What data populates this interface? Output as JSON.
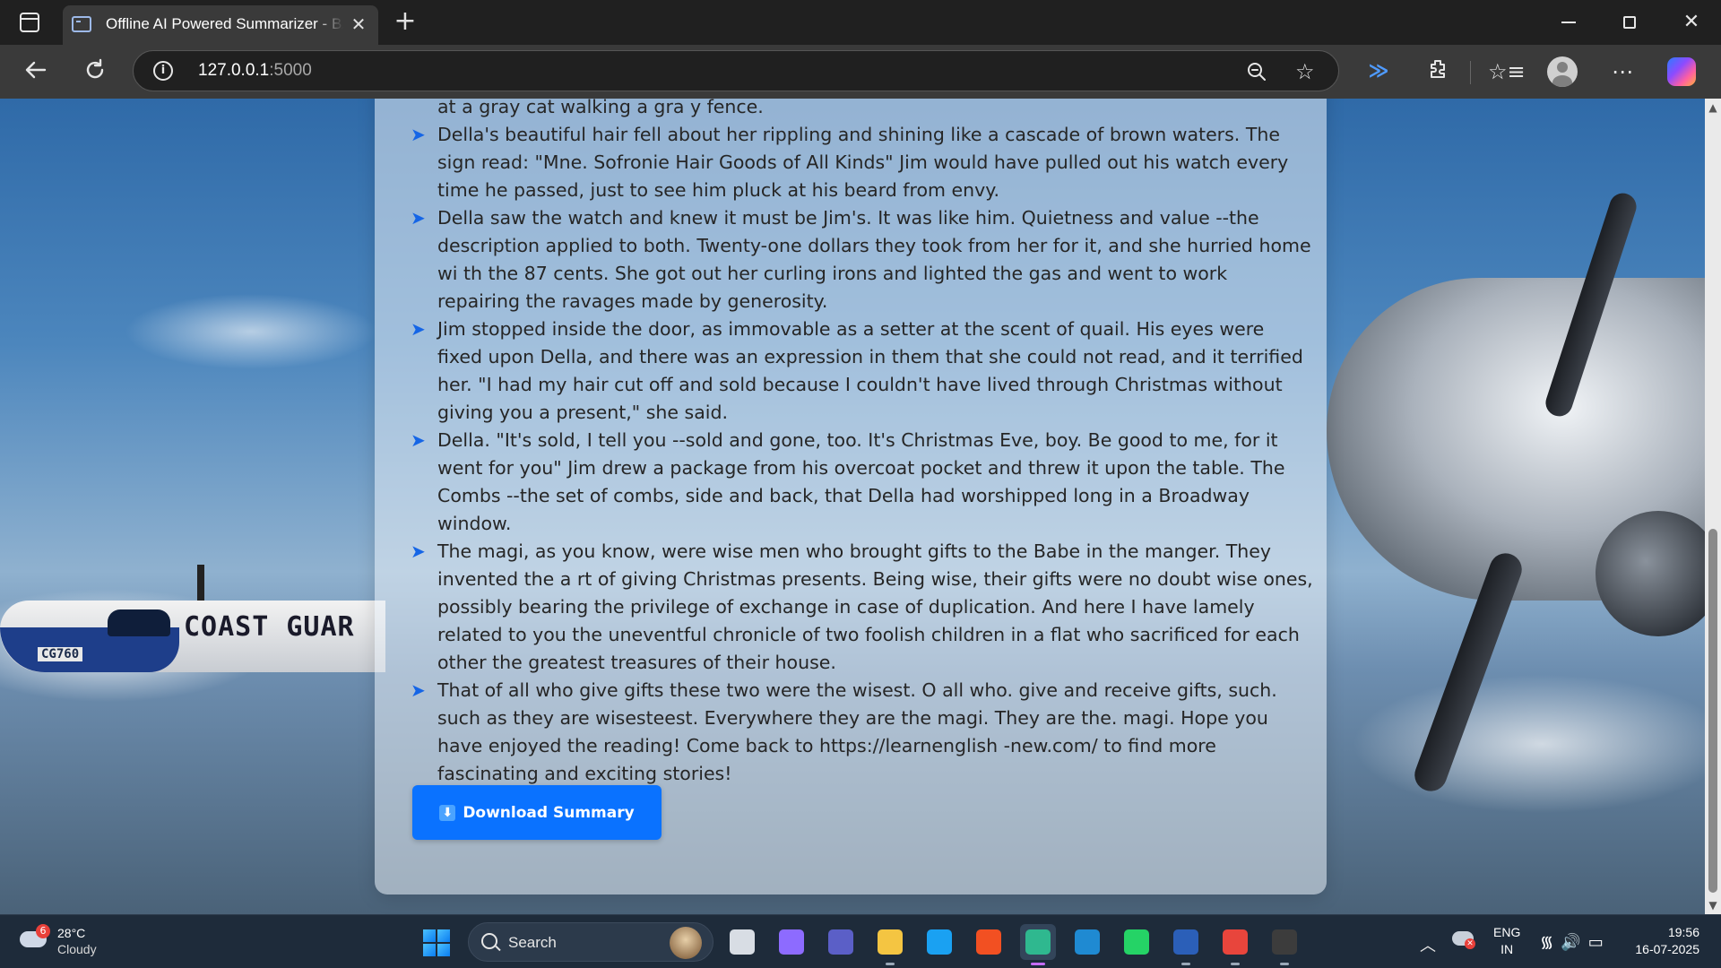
{
  "browser": {
    "tab_title": "Offline AI Powered Summarizer - BART",
    "tab_close": "✕",
    "new_tab": "+",
    "url_host": "127.0.0.1",
    "url_port": ":5000"
  },
  "summary": {
    "items": [
      "at a gray cat walking a gra y fence.",
      "Della's beautiful hair fell about her rippling and shining like a cascade of brown waters. The sign read: \"Mne. Sofronie Hair Goods of All Kinds\" Jim would have pulled out his watch every time he passed, just to see him pluck at his beard from envy.",
      "Della saw the watch and knew it must be Jim's. It was like him. Quietness and value --the description applied to both. Twenty-one dollars they took from her for it, and she hurried home wi th the 87 cents. She got out her curling irons and lighted the gas and went to work repairing the ravages made by generosity.",
      "Jim stopped inside the door, as immovable as a setter at the scent of quail. His eyes were fixed upon Della, and there was an expression in them that she could not read, and it terrified her. \"I had my hair cut off and sold because I couldn't have lived through Christmas without giving you a present,\" she said.",
      "Della. \"It's sold, I tell you --sold and gone, too. It's Christmas Eve, boy. Be good to me, for it went for you\" Jim drew a package from his overcoat pocket and threw it upon the table. The Combs --the set of combs, side and back, that Della had worshipped long in a Broadway window.",
      "The magi, as you know, were wise men who brought gifts to the Babe in the manger. They invented the a rt of giving Christmas presents. Being wise, their gifts were no doubt wise ones, possibly bearing the privilege of exchange in case of duplication. And here I have lamely related to you the uneventful chronicle of two foolish children in a flat who sacrificed for each other the greatest treasures of their house.",
      "That of all who give gifts these two were the wisest. O all who. give and receive gifts, such. such as they are wisesteest. Everywhere they are the magi. They are the. magi. Hope you have enjoyed the reading! Come back to https://learnenglish -new.com/ to find more fascinating and exciting stories!"
    ],
    "bullet": "➤",
    "download_label": "Download Summary",
    "download_icon": "⬇"
  },
  "background": {
    "plane_text": "COAST GUAR",
    "plane_reg": "CG760"
  },
  "taskbar": {
    "weather_temp": "28°C",
    "weather_condition": "Cloudy",
    "weather_badge": "6",
    "search_label": "Search",
    "lang_line1": "ENG",
    "lang_line2": "IN",
    "time": "19:56",
    "date": "16-07-2025",
    "apps": [
      {
        "name": "task-view",
        "color": "#d8dde4"
      },
      {
        "name": "copilot",
        "color": "#8d6bff"
      },
      {
        "name": "teams",
        "color": "#5b5fc7"
      },
      {
        "name": "file-explorer",
        "color": "#f4c542"
      },
      {
        "name": "cortana",
        "color": "#1aa1f2"
      },
      {
        "name": "microsoft-store",
        "color": "#f25022"
      },
      {
        "name": "edge",
        "color": "#2fb88f"
      },
      {
        "name": "vscode",
        "color": "#1f8ad2"
      },
      {
        "name": "whatsapp",
        "color": "#25d366"
      },
      {
        "name": "word",
        "color": "#2b5fb8"
      },
      {
        "name": "chrome",
        "color": "#e8453c"
      },
      {
        "name": "terminal",
        "color": "#3c3c3c"
      }
    ]
  },
  "colors": {
    "accent": "#0a72ff",
    "bullet": "#1565e6"
  }
}
